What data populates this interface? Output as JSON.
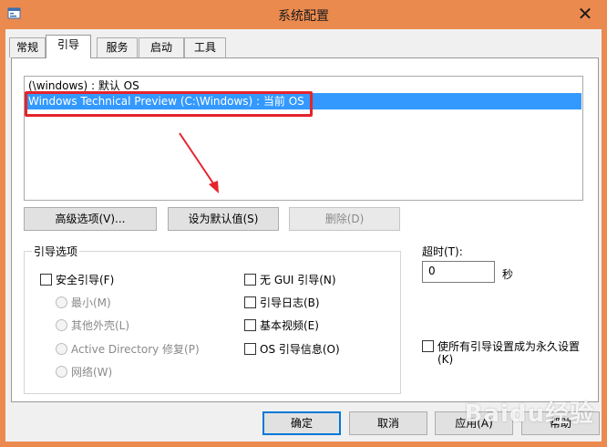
{
  "window": {
    "title": "系统配置",
    "close_symbol": "✕",
    "icon": "msconfig-icon"
  },
  "tabs": [
    {
      "label": "常规",
      "active": false
    },
    {
      "label": "引导",
      "active": true
    },
    {
      "label": "服务",
      "active": false
    },
    {
      "label": "启动",
      "active": false
    },
    {
      "label": "工具",
      "active": false
    }
  ],
  "os_list": [
    {
      "label": "(\\windows) : 默认 OS",
      "selected": false
    },
    {
      "label": "Windows Technical Preview (C:\\Windows) : 当前 OS",
      "selected": true
    }
  ],
  "buttons": {
    "advanced": "高级选项(V)...",
    "set_default": "设为默认值(S)",
    "delete": "删除(D)"
  },
  "boot_options": {
    "title": "引导选项",
    "safe_boot": "安全引导(F)",
    "minimal": "最小(M)",
    "alternate_shell": "其他外壳(L)",
    "active_directory_repair": "Active Directory 修复(P)",
    "network": "网络(W)",
    "no_gui_boot": "无 GUI 引导(N)",
    "boot_log": "引导日志(B)",
    "base_video": "基本视频(E)",
    "os_boot_info": "OS 引导信息(O)"
  },
  "timeout": {
    "label": "超时(T):",
    "value": "0",
    "unit": "秒"
  },
  "permanent": {
    "label_line1": "使所有引导设置成为永久设置",
    "label_line2": "(K)"
  },
  "footer": {
    "ok": "确定",
    "cancel": "取消",
    "apply": "应用(A)",
    "help": "帮助"
  },
  "annotation": {
    "highlight_color": "#e5242b"
  },
  "watermark": {
    "text": "Baidu经验"
  }
}
